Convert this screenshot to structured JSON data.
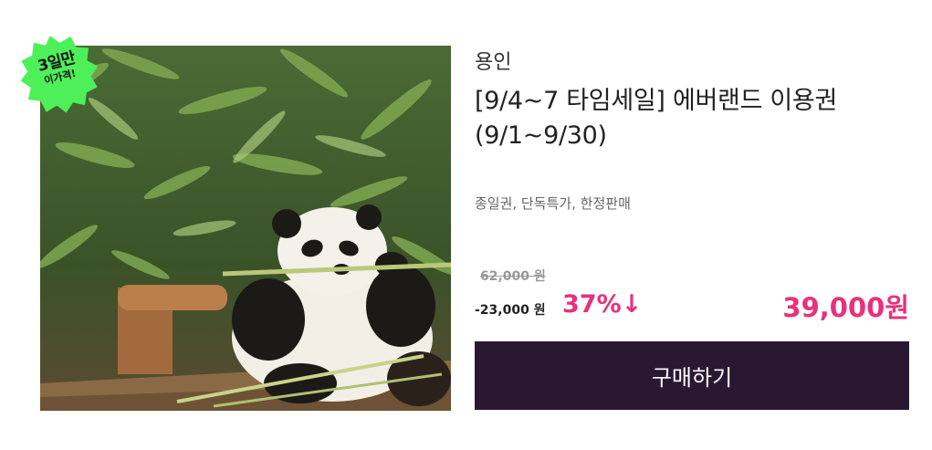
{
  "badge": {
    "line1": "3일만",
    "line2": "이가격!",
    "color": "#4ef05a"
  },
  "product": {
    "location": "용인",
    "title": "[9/4~7 타임세일] 에버랜드 이용권(9/1~9/30)",
    "tags": "종일권, 단독특가, 한정판매",
    "original_price": "62,000 원",
    "discount_amount": "-23,000 원",
    "discount_rate": "37%↓",
    "sale_price": "39,000원",
    "image": "panda-eating-bamboo-photo"
  },
  "buy_button": {
    "label": "구매하기",
    "color": "#2a1833"
  },
  "colors": {
    "accent": "#e8317a"
  }
}
